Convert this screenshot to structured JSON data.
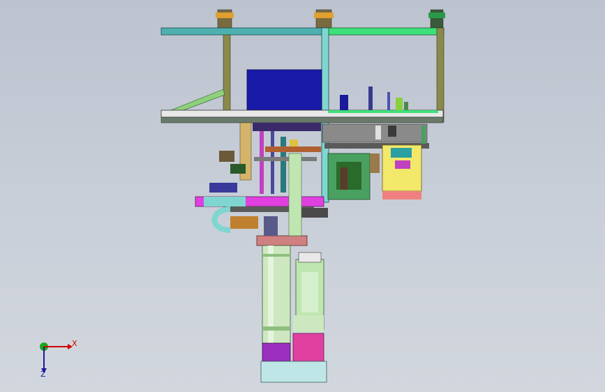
{
  "viewport": {
    "background_top": "#bcc3cf",
    "background_bottom": "#d2d7de"
  },
  "triad": {
    "x_label": "X",
    "z_label": "Z",
    "x_color": "#d10000",
    "y_color": "#1aa81a",
    "z_color": "#1a1a9a"
  },
  "model": {
    "frame_color": "#7fd6d0",
    "rail_color": "#3ee07a",
    "post_color": "#8a8a4a",
    "block_color": "#1a1aa8",
    "motor_color": "#bfe6b0",
    "column_color": "#cde8c0",
    "base_color": "#9b2fbf",
    "cam_color": "#f2e86a"
  }
}
